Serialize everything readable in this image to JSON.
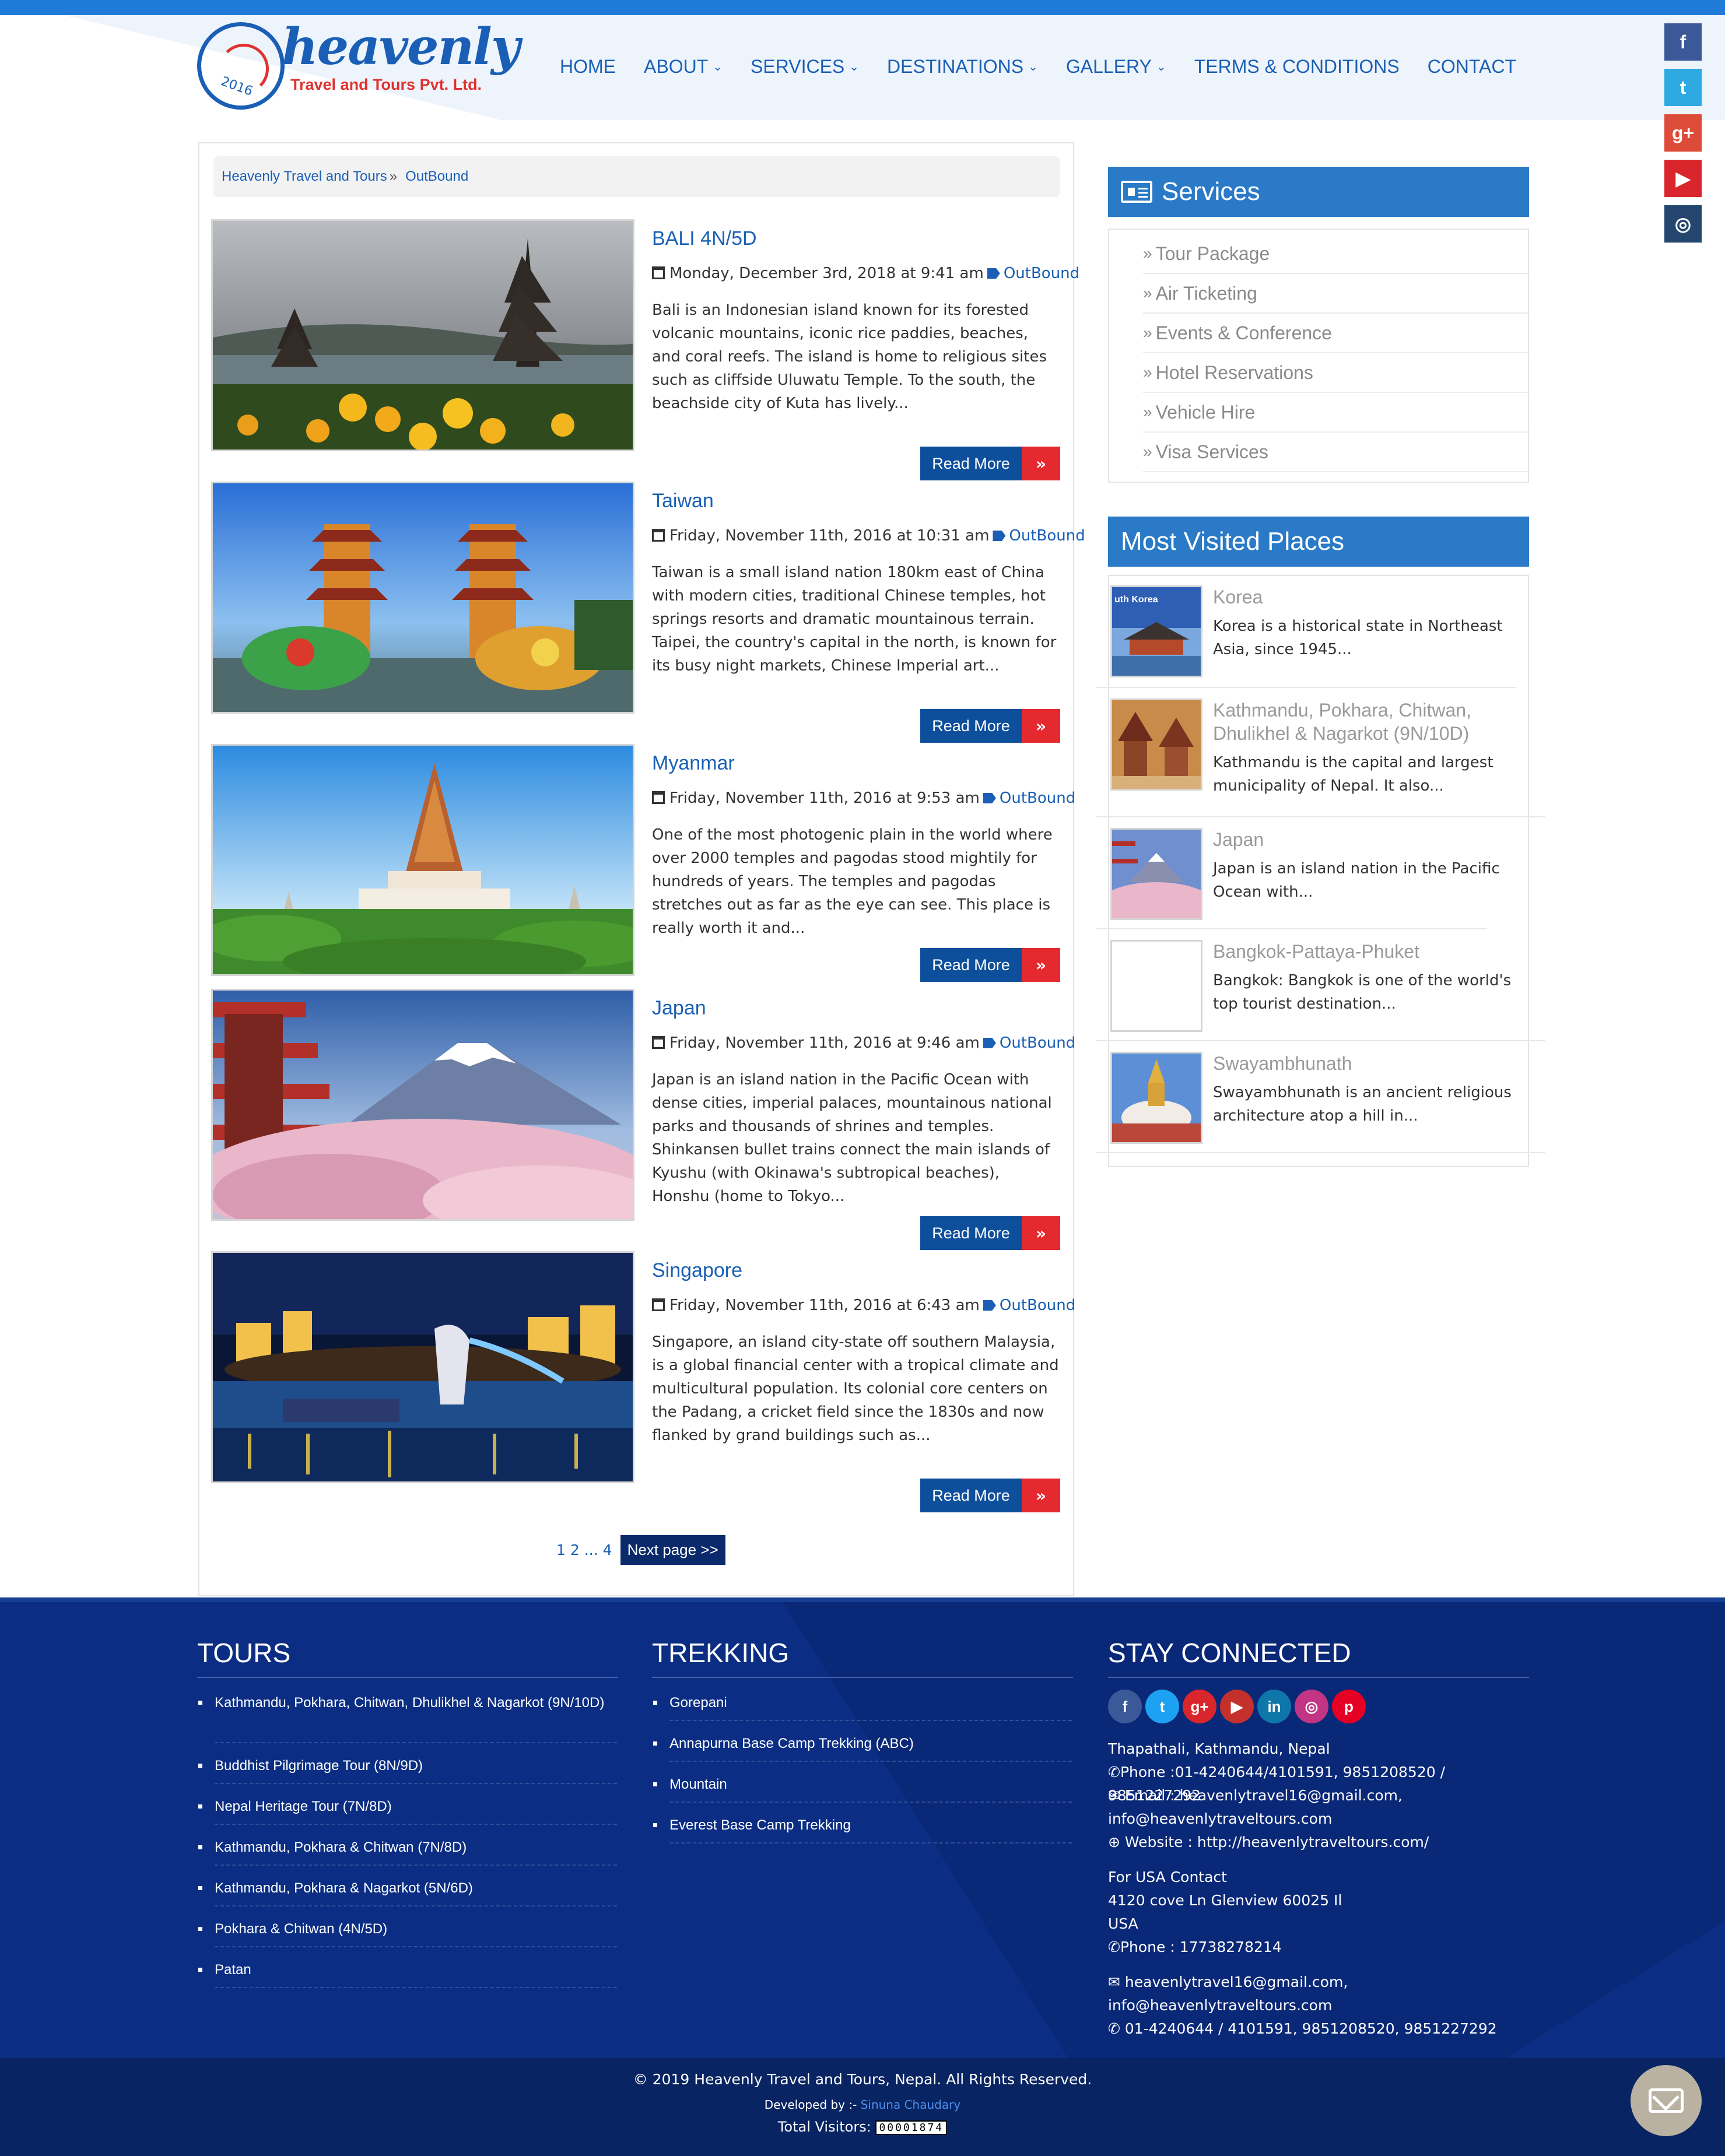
{
  "site": {
    "logo_title": "heavenly",
    "logo_subtitle": "Travel and Tours Pvt. Ltd.",
    "logo_year": "2016"
  },
  "nav": {
    "items": [
      {
        "label": "HOME",
        "has_dropdown": false
      },
      {
        "label": "ABOUT",
        "has_dropdown": true
      },
      {
        "label": "SERVICES",
        "has_dropdown": true
      },
      {
        "label": "DESTINATIONS",
        "has_dropdown": true
      },
      {
        "label": "GALLERY",
        "has_dropdown": true
      },
      {
        "label": "TERMS & CONDITIONS",
        "has_dropdown": false
      },
      {
        "label": "CONTACT",
        "has_dropdown": false
      }
    ]
  },
  "social_rail": [
    {
      "icon": "facebook-icon",
      "glyph": "f",
      "color": "#3b5998"
    },
    {
      "icon": "twitter-icon",
      "glyph": "t",
      "color": "#2ea9e1"
    },
    {
      "icon": "google-plus-icon",
      "glyph": "g+",
      "color": "#dd4b39"
    },
    {
      "icon": "youtube-icon",
      "glyph": "▶",
      "color": "#d9262c"
    },
    {
      "icon": "instagram-icon",
      "glyph": "◎",
      "color": "#24466f"
    }
  ],
  "breadcrumb": {
    "home": "Heavenly Travel and Tours",
    "separator": "»",
    "current": "OutBound"
  },
  "posts": [
    {
      "title": "BALI 4N/5D",
      "date": "Monday, December 3rd, 2018 at 9:41 am",
      "category": "OutBound",
      "excerpt": "Bali is an Indonesian island known for its forested volcanic mountains, iconic rice paddies, beaches, and coral reefs. The island is home to religious sites such as cliffside Uluwatu Temple. To the south, the beachside city of Kuta has lively...",
      "read_more": "Read More"
    },
    {
      "title": "Taiwan",
      "date": "Friday, November 11th, 2016 at 10:31 am",
      "category": "OutBound",
      "excerpt": "Taiwan is a small island nation 180km east of China with modern cities, traditional Chinese temples, hot springs resorts and dramatic mountainous terrain. Taipei, the country's capital in the north, is known for its busy night markets, Chinese Imperial art...",
      "read_more": "Read More"
    },
    {
      "title": "Myanmar",
      "date": "Friday, November 11th, 2016 at 9:53 am",
      "category": "OutBound",
      "excerpt": "One of the most photogenic plain in the world where over 2000 temples and pagodas stood mightily for hundreds of years. The temples and pagodas stretches out as far as the eye can see. This place is really worth it and...",
      "read_more": "Read More"
    },
    {
      "title": "Japan",
      "date": "Friday, November 11th, 2016 at 9:46 am",
      "category": "OutBound",
      "excerpt": "Japan is an island nation in the Pacific Ocean with dense cities, imperial palaces, mountainous national parks and thousands of shrines and temples. Shinkansen bullet trains connect the main islands of Kyushu (with Okinawa's subtropical beaches), Honshu (home to Tokyo...",
      "read_more": "Read More"
    },
    {
      "title": "Singapore",
      "date": "Friday, November 11th, 2016 at 6:43 am",
      "category": "OutBound",
      "excerpt": "Singapore, an island city-state off southern Malaysia, is a global financial center with a tropical climate and multicultural population. Its colonial core centers on the Padang, a cricket field since the 1830s and now flanked by grand buildings such as...",
      "read_more": "Read More"
    }
  ],
  "pagination": {
    "pages": [
      "1",
      "2",
      "...",
      "4"
    ],
    "next_label": "Next page >>"
  },
  "sidebar": {
    "services_title": "Services",
    "services": [
      "Tour Package",
      "Air Ticketing",
      "Events & Conference",
      "Hotel Reservations",
      "Vehicle Hire",
      "Visa Services"
    ],
    "places_title": "Most Visited Places",
    "places": [
      {
        "title": "Korea",
        "text": "Korea is a historical state in Northeast Asia, since 1945...",
        "thumb_label": "uth Korea"
      },
      {
        "title": "Kathmandu, Pokhara, Chitwan, Dhulikhel & Nagarkot (9N/10D)",
        "text": "Kathmandu is the capital and largest municipality of Nepal. It also..."
      },
      {
        "title": "Japan",
        "text": "Japan is an island nation in the Pacific Ocean with..."
      },
      {
        "title": "Bangkok-Pattaya-Phuket",
        "text": "Bangkok:  Bangkok is one of the world's top tourist destination..."
      },
      {
        "title": "Swayambhunath",
        "text": "Swayambhunath is an ancient religious architecture atop a hill in..."
      }
    ]
  },
  "footer": {
    "tours_title": "TOURS",
    "tours": [
      "Kathmandu, Pokhara, Chitwan, Dhulikhel & Nagarkot (9N/10D)",
      "Buddhist Pilgrimage Tour (8N/9D)",
      "Nepal Heritage Tour (7N/8D)",
      "Kathmandu, Pokhara & Chitwan (7N/8D)",
      "Kathmandu, Pokhara & Nagarkot (5N/6D)",
      "Pokhara & Chitwan (4N/5D)",
      "Patan"
    ],
    "trekking_title": "TREKKING",
    "trekking": [
      "Gorepani",
      "Annapurna Base Camp Trekking (ABC)",
      "Mountain",
      "Everest Base Camp Trekking"
    ],
    "stay_title": "STAY CONNECTED",
    "social": [
      {
        "icon": "facebook-icon",
        "glyph": "f",
        "color": "#3b5998"
      },
      {
        "icon": "twitter-icon",
        "glyph": "t",
        "color": "#1da1f2"
      },
      {
        "icon": "google-plus-icon",
        "glyph": "g+",
        "color": "#d9262c"
      },
      {
        "icon": "youtube-icon",
        "glyph": "▶",
        "color": "#c4302b"
      },
      {
        "icon": "linkedin-icon",
        "glyph": "in",
        "color": "#0e76a8"
      },
      {
        "icon": "instagram-icon",
        "glyph": "◎",
        "color": "#c13584"
      },
      {
        "icon": "pinterest-icon",
        "glyph": "p",
        "color": "#e60023"
      }
    ],
    "address": "Thapathali, Kathmandu, Nepal",
    "phone": "Phone :01-4240644/4101591, 9851208520 / 9851227292",
    "email_line1": "Email : heavenlytravel16@gmail.com,",
    "email_line2": "info@heavenlytraveltours.com",
    "website": "Website : http://heavenlytraveltours.com/",
    "usa_title": "For USA Contact",
    "usa_address1": "4120 cove Ln Glenview 60025 Il",
    "usa_address2": "USA",
    "usa_phone": "Phone : 17738278214",
    "email2_line1": "heavenlytravel16@gmail.com,",
    "email2_line2": "info@heavenlytraveltours.com",
    "phone2": "01-4240644 / 4101591, 9851208520, 9851227292"
  },
  "bottom": {
    "copyright": "© 2019 Heavenly Travel and Tours, Nepal. All Rights Reserved.",
    "developed_by_label": "Developed by :-",
    "developer": "Sinuna Chaudary",
    "visitors_label": "Total Visitors:",
    "visitors_count": "00001874"
  }
}
